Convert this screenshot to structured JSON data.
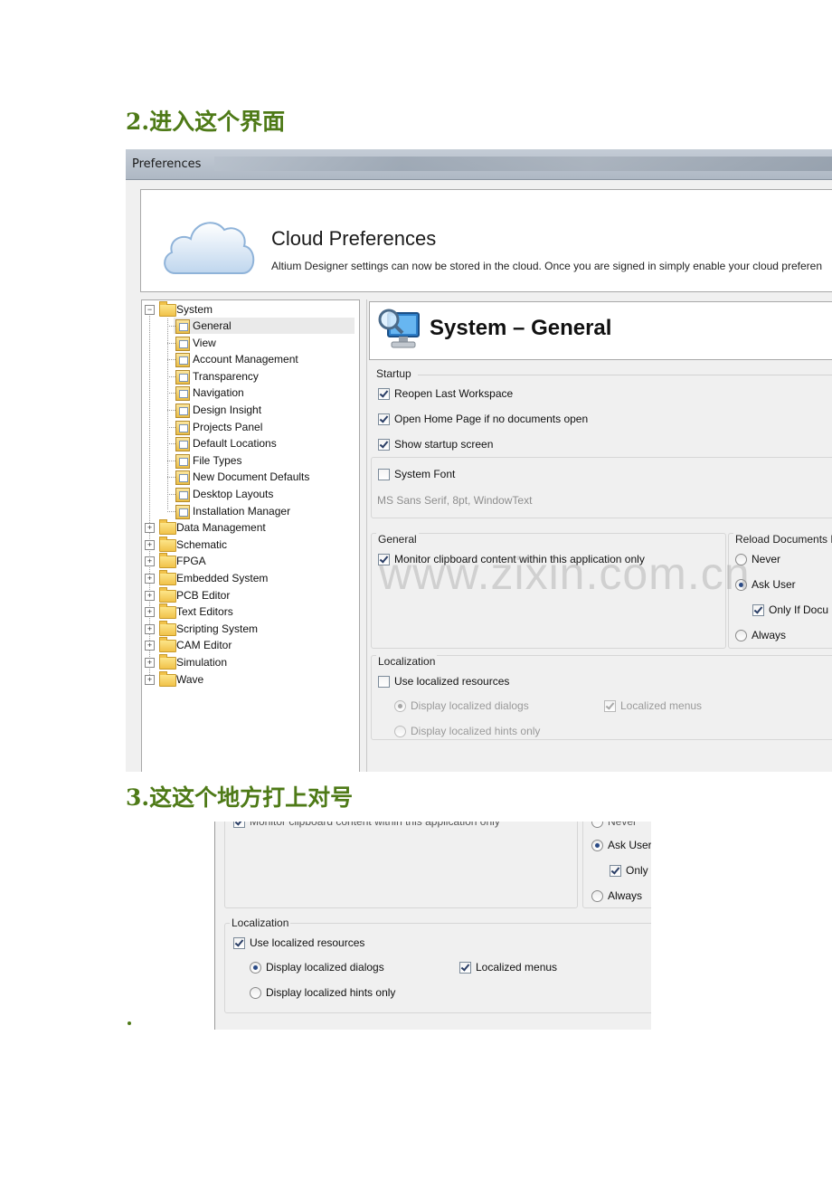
{
  "steps": {
    "step2": "2.进入这个界面",
    "step3": "3.这这个地方打上对号"
  },
  "window": {
    "title": "Preferences"
  },
  "cloud": {
    "title": "Cloud Preferences",
    "description": "Altium Designer settings can now be stored in the cloud. Once you are signed in simply enable your cloud preferen"
  },
  "tree": {
    "root": "System",
    "children": [
      "General",
      "View",
      "Account Management",
      "Transparency",
      "Navigation",
      "Design Insight",
      "Projects Panel",
      "Default Locations",
      "File Types",
      "New Document Defaults",
      "Desktop Layouts",
      "Installation Manager"
    ],
    "others": [
      "Data Management",
      "Schematic",
      "FPGA",
      "Embedded System",
      "PCB Editor",
      "Text Editors",
      "Scripting System",
      "CAM Editor",
      "Simulation",
      "Wave"
    ]
  },
  "panel": {
    "title": "System – General",
    "startup": {
      "label": "Startup",
      "reopen": "Reopen Last Workspace",
      "home": "Open Home Page if no documents open",
      "splash": "Show startup screen"
    },
    "font": {
      "label": "System Font",
      "value": "MS Sans Serif, 8pt, WindowText"
    },
    "general": {
      "label": "General",
      "clipboard": "Monitor clipboard content within this application only"
    },
    "reload": {
      "label": "Reload Documents M",
      "never": "Never",
      "ask": "Ask User",
      "only": "Only If Docu",
      "always": "Always"
    },
    "localization": {
      "label": "Localization",
      "use": "Use localized resources",
      "dialogs": "Display localized dialogs",
      "menus": "Localized menus",
      "hints": "Display localized hints only"
    }
  },
  "zoom": {
    "clipboard_partial": "Monitor clipboard content within this application only",
    "never_partial": "Never",
    "ask": "Ask User",
    "only": "Only",
    "always": "Always",
    "localization": "Localization",
    "use": "Use localized resources",
    "dialogs": "Display localized dialogs",
    "menus": "Localized menus",
    "hints": "Display localized hints only"
  },
  "watermark": "www.zixin.com.cn",
  "colors": {
    "heading": "#4e7a17",
    "dialog_bg": "#f0f0f0"
  }
}
